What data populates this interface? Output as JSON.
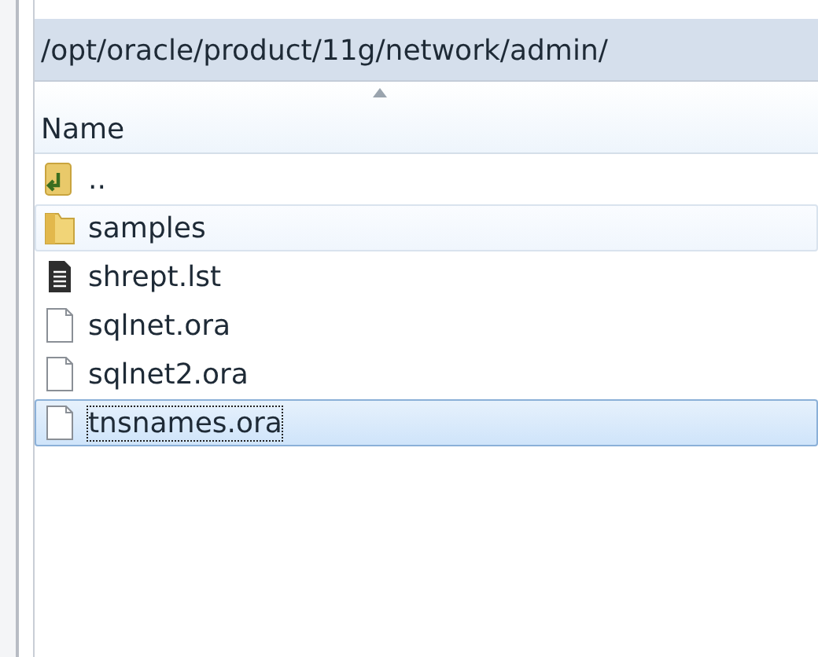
{
  "path_bar": {
    "path": "/opt/oracle/product/11g/network/admin/"
  },
  "table": {
    "columns": [
      {
        "label": "Name",
        "sorted": true
      }
    ],
    "rows": [
      {
        "name": "..",
        "kind": "parent",
        "selected": false,
        "hovered": false
      },
      {
        "name": "samples",
        "kind": "folder",
        "selected": false,
        "hovered": true
      },
      {
        "name": "shrept.lst",
        "kind": "text",
        "selected": false,
        "hovered": false
      },
      {
        "name": "sqlnet.ora",
        "kind": "file",
        "selected": false,
        "hovered": false
      },
      {
        "name": "sqlnet2.ora",
        "kind": "file",
        "selected": false,
        "hovered": false
      },
      {
        "name": "tnsnames.ora",
        "kind": "file",
        "selected": true,
        "hovered": false
      }
    ]
  }
}
